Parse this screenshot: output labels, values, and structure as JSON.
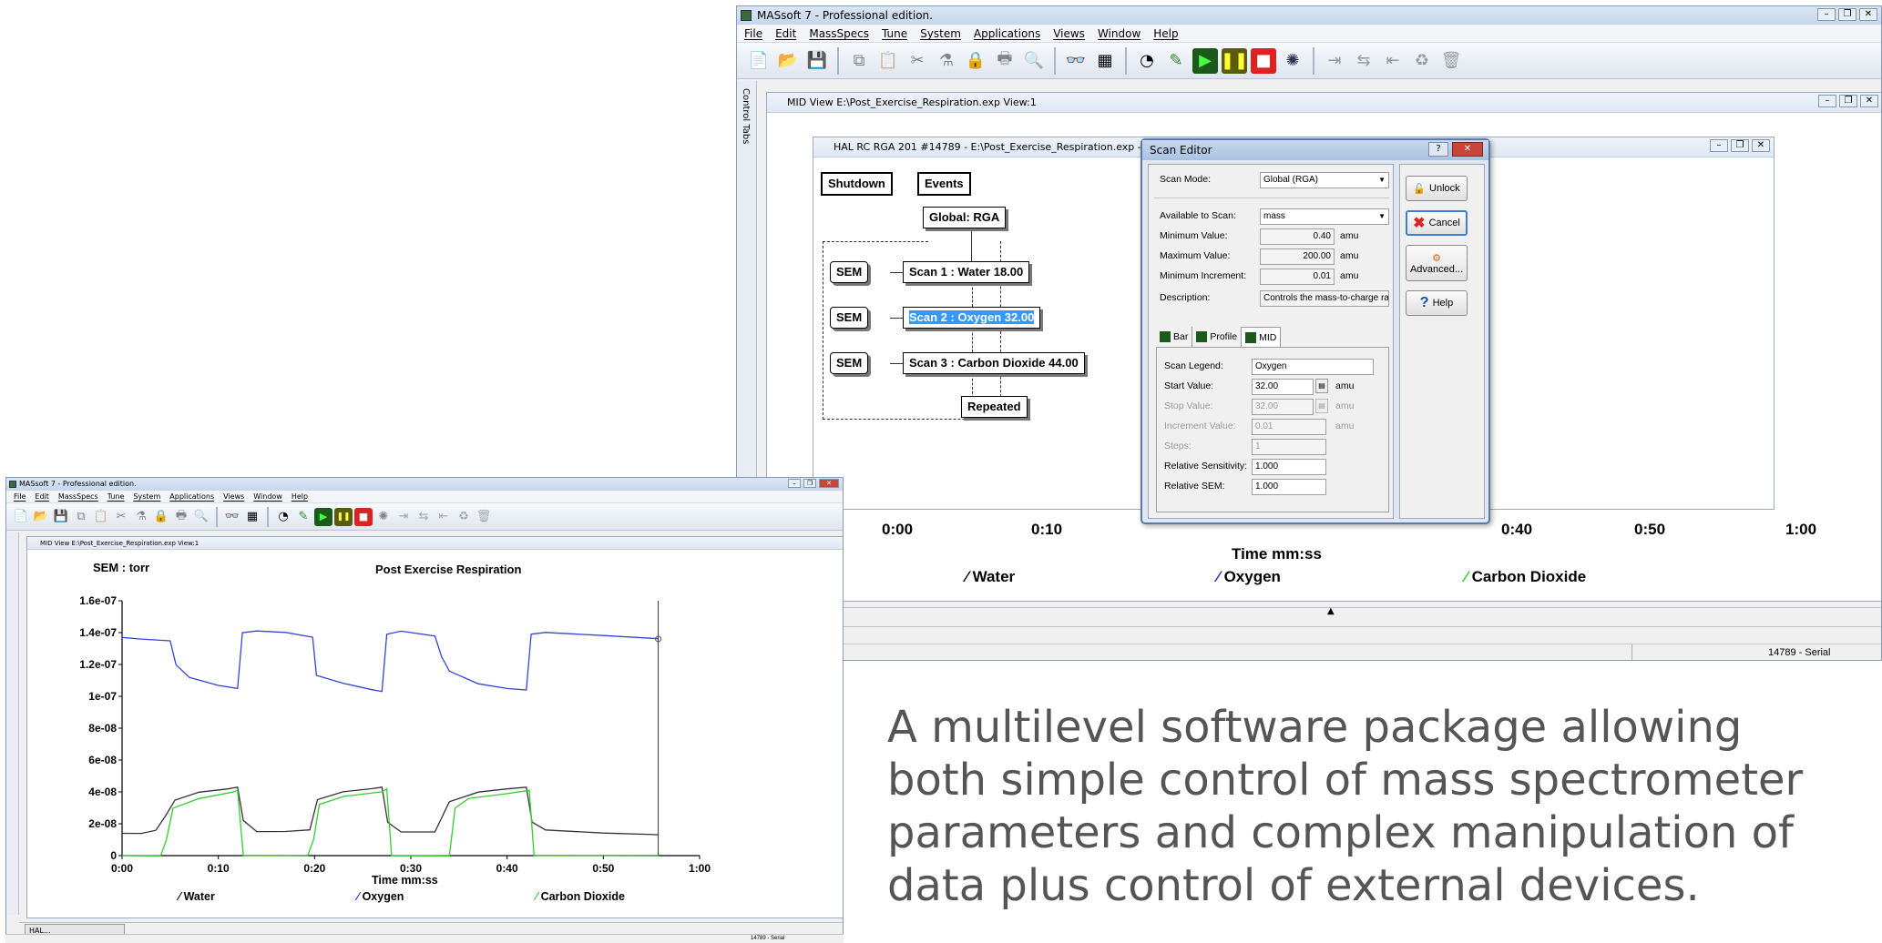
{
  "main_app": {
    "title": "MASsoft 7 -  Professional edition.",
    "menu": [
      "File",
      "Edit",
      "MassSpecs",
      "Tune",
      "System",
      "Applications",
      "Views",
      "Window",
      "Help"
    ],
    "control_tabs_label": "Control Tabs",
    "mid_view_title": "MID View   E:\\Post_Exercise_Respiration.exp View:1",
    "rga_window_title": "HAL RC RGA 201 #14789 - E:\\Post_Exercise_Respiration.exp - RGA",
    "flow": {
      "shutdown": "Shutdown",
      "events": "Events",
      "global": "Global: RGA",
      "sem": "SEM",
      "scan1": "Scan 1 : Water 18.00",
      "scan2": "Scan 2 : Oxygen 32.00",
      "scan3": "Scan 3 : Carbon Dioxide 44.00",
      "repeated": "Repeated"
    },
    "x_ticks": [
      "0:00",
      "0:10",
      "0:20",
      "0:30",
      "0:40",
      "0:50",
      "1:00"
    ],
    "x_label": "Time  mm:ss",
    "legend": [
      "Water",
      "Oxygen",
      "Carbon Dioxide"
    ],
    "legend_colors": [
      "#000000",
      "#2233cc",
      "#33cc33"
    ],
    "status_serial": "14789 - Serial"
  },
  "scan_editor": {
    "title": "Scan Editor",
    "scan_mode_label": "Scan Mode:",
    "scan_mode_value": "Global (RGA)",
    "available_label": "Available to Scan:",
    "available_value": "mass",
    "min_value_label": "Minimum Value:",
    "min_value": "0.40",
    "max_value_label": "Maximum Value:",
    "max_value": "200.00",
    "min_inc_label": "Minimum Increment:",
    "min_inc": "0.01",
    "unit": "amu",
    "description_label": "Description:",
    "description_value": "Controls the mass-to-charge rati",
    "tabs": [
      "Bar",
      "Profile",
      "MID"
    ],
    "scan_legend_label": "Scan Legend:",
    "scan_legend_value": "Oxygen",
    "start_label": "Start Value:",
    "start_value": "32.00",
    "stop_label": "Stop Value:",
    "stop_value": "32.00",
    "increment_label": "Increment Value:",
    "increment_value": "0.01",
    "steps_label": "Steps:",
    "steps_value": "1",
    "rel_sens_label": "Relative Sensitivity:",
    "rel_sens_value": "1.000",
    "rel_sem_label": "Relative SEM:",
    "rel_sem_value": "1.000",
    "buttons": {
      "unlock": "Unlock",
      "cancel": "Cancel",
      "advanced": "Advanced...",
      "help": "Help"
    }
  },
  "small_app": {
    "title": "MASsoft 7 -  Professional edition.",
    "menu": [
      "File",
      "Edit",
      "MassSpecs",
      "Tune",
      "System",
      "Applications",
      "Views",
      "Window",
      "Help"
    ],
    "mid_view_title": "MID View   E:\\Post_Exercise_Respiration.exp View:1",
    "taskbar_item": "HAL...",
    "status_serial": "14789 - Serial"
  },
  "chart_data": {
    "type": "line",
    "title": "Post Exercise Respiration",
    "unit_label": "SEM : torr",
    "xlabel": "Time  mm:ss",
    "ylabel": "",
    "x_ticks": [
      "0:00",
      "0:10",
      "0:20",
      "0:30",
      "0:40",
      "0:50",
      "1:00"
    ],
    "y_ticks": [
      "0",
      "2e-08",
      "4e-08",
      "6e-08",
      "8e-08",
      "1e-07",
      "1.2e-07",
      "1.4e-07",
      "1.6e-07"
    ],
    "xlim": [
      0,
      60
    ],
    "ylim": [
      0,
      1.6e-07
    ],
    "grid": false,
    "legend_position": "bottom",
    "cursor_x": 55.7,
    "series": [
      {
        "name": "Oxygen",
        "color": "#3344dd",
        "x": [
          0,
          2,
          5,
          5.6,
          7,
          10,
          12,
          12.5,
          14,
          17,
          19.8,
          20.2,
          23,
          26,
          27,
          27.5,
          29,
          32.5,
          33.2,
          34,
          37,
          40,
          42,
          42.5,
          44,
          50,
          55.7
        ],
        "y": [
          1.37e-07,
          1.36e-07,
          1.35e-07,
          1.2e-07,
          1.12e-07,
          1.07e-07,
          1.05e-07,
          1.4e-07,
          1.41e-07,
          1.4e-07,
          1.37e-07,
          1.13e-07,
          1.08e-07,
          1.04e-07,
          1.03e-07,
          1.39e-07,
          1.41e-07,
          1.38e-07,
          1.25e-07,
          1.16e-07,
          1.08e-07,
          1.05e-07,
          1.04e-07,
          1.39e-07,
          1.4e-07,
          1.38e-07,
          1.36e-07
        ]
      },
      {
        "name": "Water",
        "color": "#333333",
        "x": [
          0,
          2,
          3.5,
          4.5,
          5.5,
          8,
          11,
          12,
          12.6,
          14,
          17,
          19.5,
          20.3,
          23,
          26,
          27,
          27.6,
          29,
          32.5,
          34,
          37,
          40,
          42,
          42.6,
          44,
          50,
          55.7
        ],
        "y": [
          1.4e-08,
          1.4e-08,
          1.6e-08,
          2.5e-08,
          3.5e-08,
          4e-08,
          4.2e-08,
          4.3e-08,
          2.2e-08,
          1.5e-08,
          1.5e-08,
          1.6e-08,
          3.5e-08,
          4e-08,
          4.2e-08,
          4.3e-08,
          2.1e-08,
          1.5e-08,
          1.5e-08,
          3.4e-08,
          4e-08,
          4.2e-08,
          4.3e-08,
          2.1e-08,
          1.6e-08,
          1.4e-08,
          1.3e-08
        ]
      },
      {
        "name": "Carbon Dioxide",
        "color": "#33cc33",
        "x": [
          0,
          2,
          4,
          4.6,
          5.3,
          8,
          11.5,
          12,
          12.6,
          17,
          19.3,
          19.9,
          20.5,
          23,
          27,
          27.5,
          28,
          32,
          34,
          34.6,
          36,
          40,
          42.3,
          42.8,
          50,
          55.7
        ],
        "y": [
          0,
          0,
          0,
          1e-08,
          3e-08,
          3.6e-08,
          4e-08,
          4.1e-08,
          0,
          0,
          0,
          1e-08,
          3.2e-08,
          3.7e-08,
          4e-08,
          4.2e-08,
          0,
          0,
          0,
          3e-08,
          3.6e-08,
          3.9e-08,
          4.1e-08,
          0,
          0,
          0
        ]
      }
    ]
  },
  "caption": "A multilevel software package allowing both simple control of mass spectrometer parameters and complex manipulation of data plus control of external devices."
}
